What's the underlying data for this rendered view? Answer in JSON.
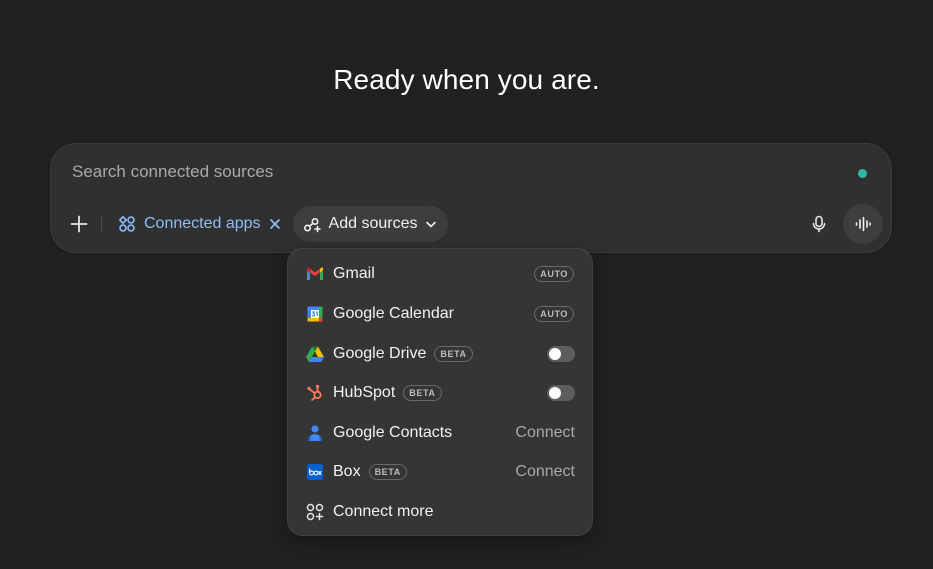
{
  "headline": "Ready when you are.",
  "composer": {
    "placeholder": "Search connected sources",
    "status_dot_color": "#2fb9a5",
    "connected_apps_label": "Connected apps",
    "add_sources_label": "Add sources",
    "icons": [
      "plus-icon",
      "apps-icon",
      "close-icon",
      "add-sources-icon",
      "chevron-down-icon",
      "microphone-icon",
      "voice-waveform-icon"
    ]
  },
  "sources_menu": {
    "items": [
      {
        "name": "Gmail",
        "icon": "gmail-icon",
        "badge": "",
        "control": "auto",
        "control_label": "AUTO"
      },
      {
        "name": "Google Calendar",
        "icon": "google-calendar-icon",
        "badge": "",
        "control": "auto",
        "control_label": "AUTO"
      },
      {
        "name": "Google Drive",
        "icon": "google-drive-icon",
        "badge": "BETA",
        "control": "toggle",
        "toggle_on": false
      },
      {
        "name": "HubSpot",
        "icon": "hubspot-icon",
        "badge": "BETA",
        "control": "toggle",
        "toggle_on": false
      },
      {
        "name": "Google Contacts",
        "icon": "google-contacts-icon",
        "badge": "",
        "control": "connect",
        "control_label": "Connect"
      },
      {
        "name": "Box",
        "icon": "box-icon",
        "badge": "BETA",
        "control": "connect",
        "control_label": "Connect"
      },
      {
        "name": "Connect more",
        "icon": "connect-more-icon",
        "badge": "",
        "control": "none"
      }
    ]
  },
  "colors": {
    "background": "#212121",
    "composer": "#303030",
    "accent_link": "#8fbdf5",
    "menu": "#353535"
  }
}
